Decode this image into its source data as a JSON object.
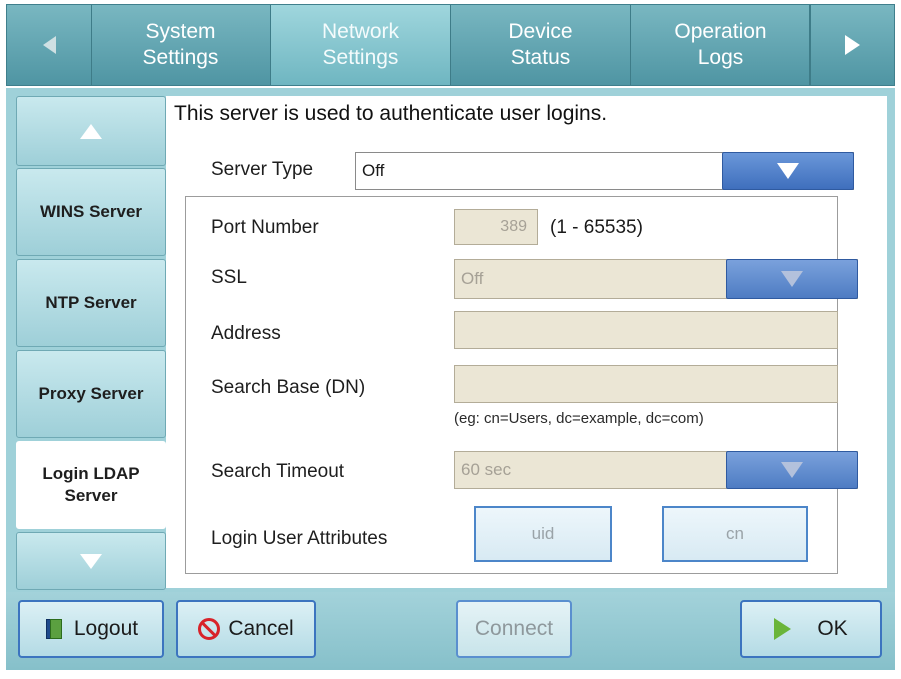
{
  "top_tabs": [
    {
      "label": "System\nSettings",
      "active": false
    },
    {
      "label": "Network\nSettings",
      "active": true
    },
    {
      "label": "Device\nStatus",
      "active": false
    },
    {
      "label": "Operation\nLogs",
      "active": false
    }
  ],
  "sidebar": {
    "items": [
      {
        "label": "WINS Server",
        "active": false
      },
      {
        "label": "NTP Server",
        "active": false
      },
      {
        "label": "Proxy Server",
        "active": false
      },
      {
        "label": "Login LDAP\nServer",
        "active": true
      }
    ]
  },
  "main": {
    "info": "This server is used to authenticate user logins.",
    "server_type": {
      "label": "Server Type",
      "value": "Off"
    },
    "port": {
      "label": "Port Number",
      "value": "389",
      "range": "(1 - 65535)"
    },
    "ssl": {
      "label": "SSL",
      "value": "Off"
    },
    "address": {
      "label": "Address",
      "value": ""
    },
    "search_base": {
      "label": "Search Base (DN)",
      "value": "",
      "hint": "(eg: cn=Users, dc=example, dc=com)"
    },
    "search_timeout": {
      "label": "Search Timeout",
      "value": "60 sec"
    },
    "login_attrs": {
      "label": "Login User Attributes",
      "options": [
        "uid",
        "cn"
      ]
    }
  },
  "footer": {
    "logout": "Logout",
    "cancel": "Cancel",
    "connect": "Connect",
    "ok": "OK"
  },
  "colors": {
    "accent_blue": "#3f6fbd",
    "teal": "#79b7c1",
    "disabled_field": "#ebe6d5"
  }
}
